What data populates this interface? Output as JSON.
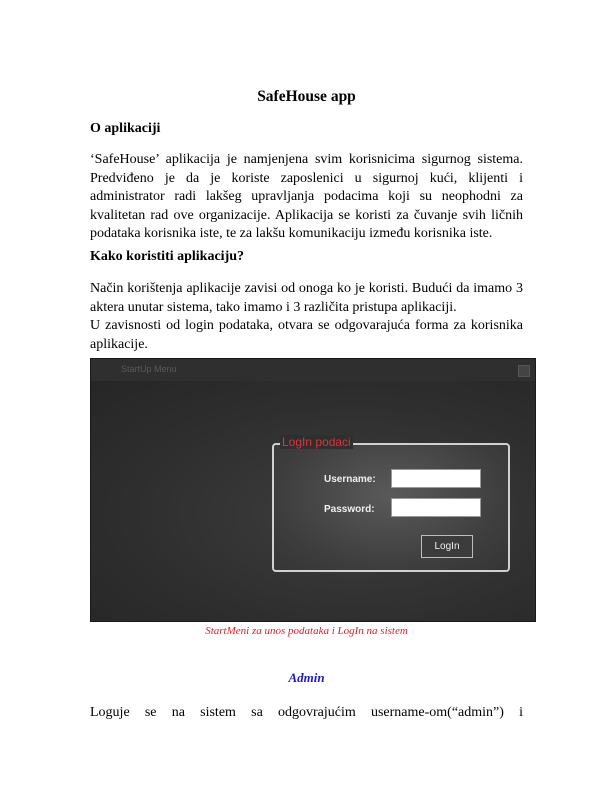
{
  "document": {
    "title": "SafeHouse app",
    "section1": {
      "heading": "O aplikaciji",
      "lines": [
        "‘SafeHouse’ aplikacija je namjenjena svim korisnicima sigurnog sistema.",
        "Predviđeno je da je koriste zaposlenici u sigurnoj kući, klijenti i",
        "administrator radi lakšeg upravljanja podacima koji su neophodni za",
        "kvalitetan rad ove organizacije. Aplikacija se koristi za čuvanje svih ličnih",
        "podataka korisnika iste, te za lakšu komunikaciju između korisnika iste."
      ]
    },
    "section2": {
      "heading": "Kako koristiti aplikaciju?",
      "lines": [
        "Način korištenja aplikacije zavisi od onoga ko je koristi. Budući da imamo 3",
        "aktera unutar sistema, tako imamo i 3 različita pristupa aplikaciji.",
        "U zavisnosti od login podataka, otvara se odgovarajuća forma za korisnika",
        "aplikacije."
      ]
    },
    "figure": {
      "window_title": "StartUp Menu",
      "group_label": "LogIn podaci",
      "username_label": "Username:",
      "password_label": "Password:",
      "username_value": "",
      "password_value": "",
      "login_button": "LogIn",
      "caption": "StartMeni za unos podataka i LogIn na sistem"
    },
    "admin": {
      "heading": "Admin",
      "line": "Loguje se na sistem sa odgovrajućim username-om(“admin”) i"
    }
  },
  "colors": {
    "caption": "#e0202a",
    "admin_heading": "#1c1cc8",
    "group_label": "#e0303a"
  }
}
